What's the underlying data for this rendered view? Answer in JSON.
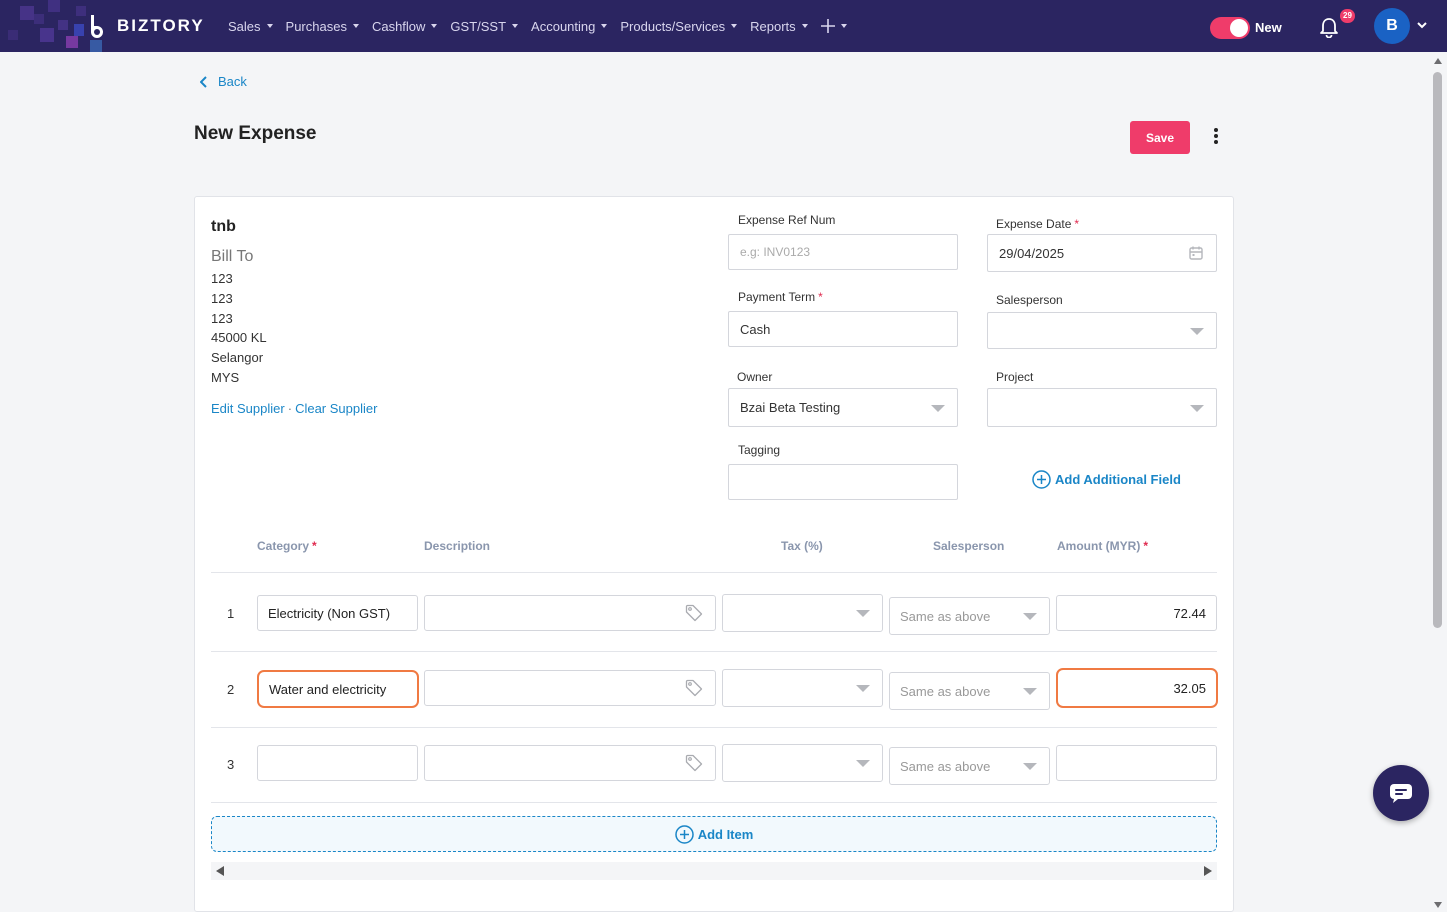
{
  "app": {
    "brand": "BIZTORY"
  },
  "nav": {
    "items": [
      "Sales",
      "Purchases",
      "Cashflow",
      "GST/SST",
      "Accounting",
      "Products/Services",
      "Reports"
    ],
    "new_label": "New",
    "notification_count": "29",
    "avatar_initial": "B"
  },
  "page": {
    "back_label": "Back",
    "title": "New Expense",
    "save_label": "Save"
  },
  "supplier": {
    "name": "tnb",
    "bill_to_label": "Bill To",
    "address_lines": [
      "123",
      "123",
      "123",
      "45000 KL",
      "Selangor",
      "MYS"
    ],
    "edit_link": "Edit Supplier",
    "separator": "·",
    "clear_link": "Clear Supplier"
  },
  "form": {
    "ref_label": "Expense Ref Num",
    "ref_placeholder": "e.g: INV0123",
    "date_label": "Expense Date",
    "date_value": "29/04/2025",
    "payment_label": "Payment Term",
    "payment_value": "Cash",
    "salesperson_label": "Salesperson",
    "owner_label": "Owner",
    "owner_value": "Bzai Beta Testing",
    "project_label": "Project",
    "tagging_label": "Tagging",
    "add_field_label": "Add Additional Field",
    "required_mark": "*"
  },
  "table": {
    "headers": {
      "category": "Category",
      "description": "Description",
      "tax": "Tax (%)",
      "salesperson": "Salesperson",
      "amount": "Amount (MYR)"
    },
    "rows": [
      {
        "num": "1",
        "category": "Electricity (Non GST)",
        "salesperson": "Same as above",
        "amount": "72.44"
      },
      {
        "num": "2",
        "category": "Water and electricity",
        "salesperson": "Same as above",
        "amount": "32.05"
      },
      {
        "num": "3",
        "category": "",
        "salesperson": "Same as above",
        "amount": ""
      }
    ],
    "add_item_label": "Add Item"
  },
  "colors": {
    "nav_bg": "#2b2561",
    "accent": "#ef3c6a",
    "link": "#1a86c7",
    "highlight": "#f07a43"
  }
}
